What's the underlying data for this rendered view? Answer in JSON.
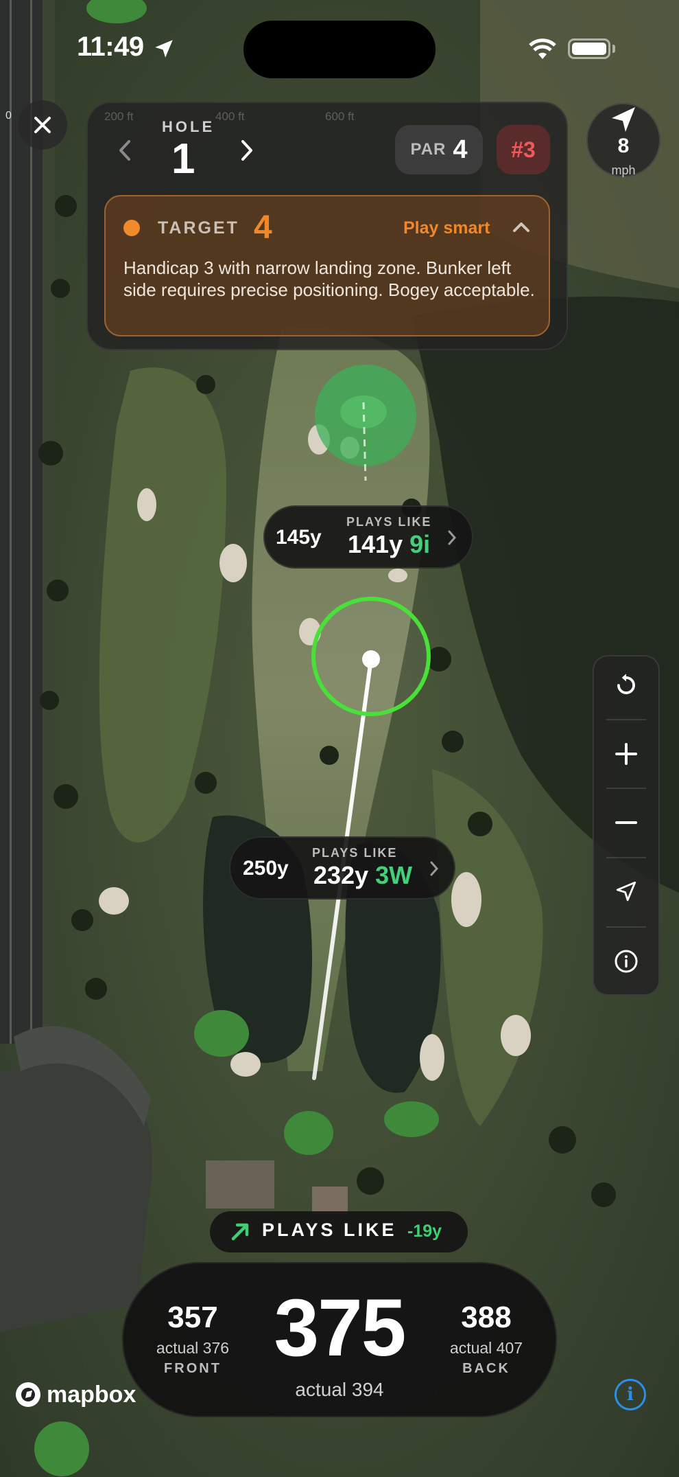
{
  "status_bar": {
    "time": "11:49"
  },
  "scale": {
    "zero": "0",
    "labels": [
      "200 ft",
      "400 ft",
      "600 ft"
    ]
  },
  "hole": {
    "label": "HOLE",
    "number": "1",
    "par_label": "PAR",
    "par_value": "4",
    "rank": "#3"
  },
  "target": {
    "label": "TARGET",
    "value": "4",
    "strategy": "Play smart",
    "description": "Handicap 3 with narrow landing zone. Bunker left side requires precise positioning. Bogey acceptable."
  },
  "wind": {
    "speed": "8",
    "unit": "mph"
  },
  "upper_pill": {
    "raw": "145y",
    "caption": "PLAYS LIKE",
    "adjusted": "141y",
    "club": "9i"
  },
  "lower_pill": {
    "raw": "250y",
    "caption": "PLAYS LIKE",
    "adjusted": "232y",
    "club": "3W"
  },
  "plays_like": {
    "label": "PLAYS LIKE",
    "delta": "-19y"
  },
  "distances": {
    "front": {
      "value": "357",
      "actual": "actual 376",
      "label": "FRONT"
    },
    "center": {
      "value": "375",
      "actual": "actual 394"
    },
    "back": {
      "value": "388",
      "actual": "actual 407",
      "label": "BACK"
    }
  },
  "attribution": {
    "brand": "mapbox",
    "info": "i"
  },
  "colors": {
    "accent_orange": "#f0882a",
    "club_green": "#44d07a",
    "rank_red": "#ef5a5a",
    "target_ring": "#49e03a",
    "info_blue": "#2b8fe6"
  }
}
